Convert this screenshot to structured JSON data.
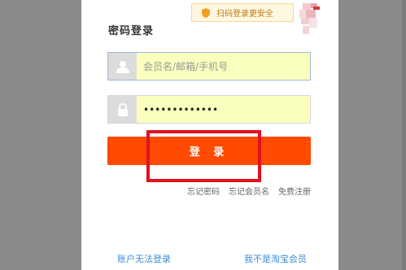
{
  "header": {
    "title": "密码登录",
    "qr_tip": "扫码登录更安全"
  },
  "form": {
    "username": {
      "placeholder": "会员名/邮箱/手机号",
      "value": ""
    },
    "password": {
      "value": "•••••••••••••"
    },
    "login_label": "登 录"
  },
  "links": {
    "forgot_password": "忘记密码",
    "forgot_username": "忘记会员名",
    "register": "免费注册"
  },
  "footer": {
    "cannot_login": "账户无法登录",
    "not_member": "我不是淘宝会员"
  },
  "colors": {
    "accent": "#ff4a00",
    "annotation_box": "#e3101e",
    "link": "#3d8cd7",
    "autofill_bg": "#faffbd"
  },
  "icons": [
    "shield-icon",
    "user-icon",
    "lock-icon",
    "qr-corner-icon"
  ]
}
